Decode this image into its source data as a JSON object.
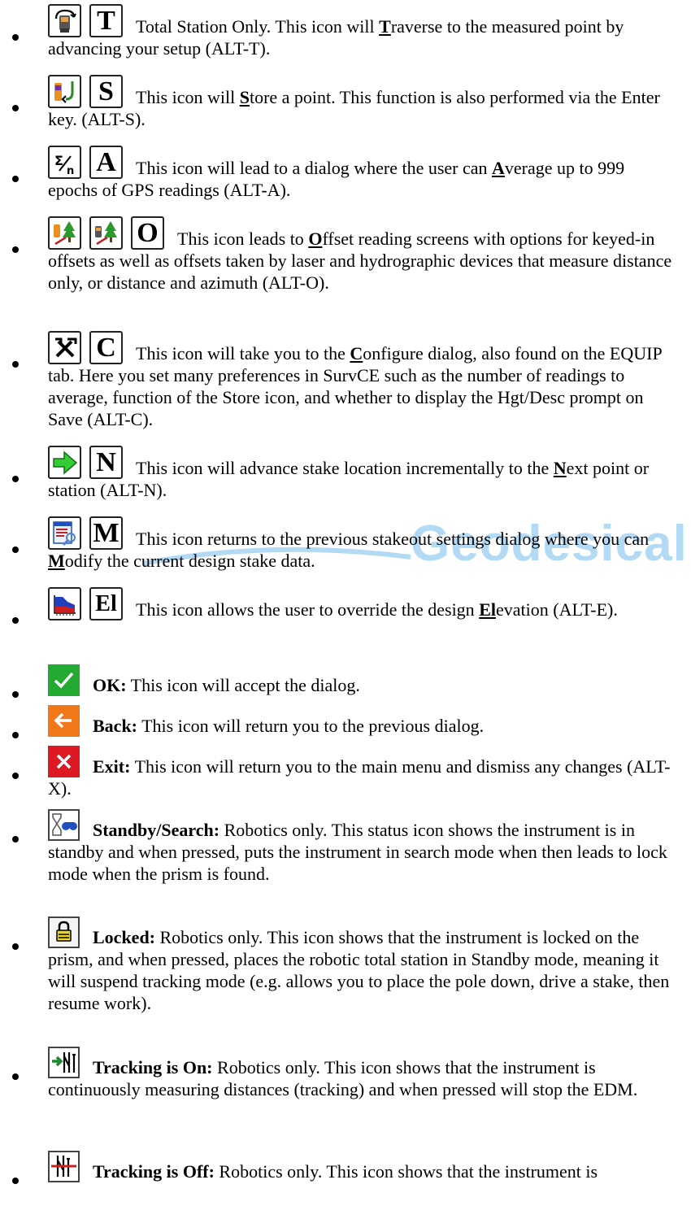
{
  "watermark": "Geodesical",
  "items": [
    {
      "icons": [
        "traverse-station-icon"
      ],
      "letter": "T",
      "text": "Total Station Only. This icon will",
      "key": "T",
      "rest": "raverse to the measured point by advancing your setup (ALT-T)."
    },
    {
      "icons": [
        "store-point-icon"
      ],
      "letter": "S",
      "text": "This icon will",
      "key": "S",
      "rest": "tore a point.  This function is also performed via the Enter key.  (ALT-S)."
    },
    {
      "icons": [
        "average-sigma-icon"
      ],
      "letter": "A",
      "text": "This icon will lead to a dialog where the user can",
      "key": "A",
      "rest": "verage up to 999 epochs of GPS readings (ALT-A)."
    },
    {
      "icons": [
        "offset-gps-icon",
        "offset-total-station-icon"
      ],
      "letter": "O",
      "text": "This icon leads to",
      "key": "O",
      "rest": "ffset reading screens with options for keyed-in offsets as well as offsets taken by laser and hydrographic devices that measure distance only, or distance and azimuth (ALT-O)."
    },
    {
      "icons": [
        "configure-tools-icon"
      ],
      "letter": "C",
      "text": "This icon will take you to the",
      "key": "C",
      "rest": "onfigure dialog, also found on the EQUIP tab.  Here you set many preferences in SurvCE such as the number of readings to average,  function of the Store icon, and whether to display the Hgt/Desc prompt on Save (ALT-C)."
    },
    {
      "icons": [
        "next-arrow-icon"
      ],
      "letter": "N",
      "text": "This icon will advance stake location incrementally to the",
      "key": "N",
      "rest": "ext point or station (ALT-N)."
    },
    {
      "icons": [
        "modify-stake-icon"
      ],
      "letter": "M",
      "text": "This icon returns to the previous stakeout settings dialog where you can",
      "key": "M",
      "rest": "odify the current design stake data."
    },
    {
      "icons": [
        "elevation-profile-icon"
      ],
      "letter": "El",
      "text": "This icon allows the user to override the design",
      "key": "El",
      "rest": "evation (ALT-E)."
    },
    {
      "icons": [
        "ok-check-icon"
      ],
      "letter": "",
      "label": "OK:",
      "text": "This icon will accept the dialog."
    },
    {
      "icons": [
        "back-arrow-icon"
      ],
      "letter": "",
      "label": "Back:",
      "text": "This icon will return you to the previous dialog."
    },
    {
      "icons": [
        "exit-x-icon"
      ],
      "letter": "",
      "label": "Exit:",
      "text": "This icon will return you to the main menu and dismiss any changes (ALT-X)."
    },
    {
      "icons": [
        "standby-search-icon"
      ],
      "letter": "",
      "label": "Standby/Search:",
      "text": "Robotics only. This status icon shows the instrument is in standby and when pressed, puts the instrument in search mode when then leads to lock mode when the prism is found."
    },
    {
      "icons": [
        "locked-padlock-icon"
      ],
      "letter": "",
      "label": "Locked:",
      "text": "Robotics only. This icon shows that the instrument is locked on the prism, and when pressed, places the robotic total station in Standby mode, meaning it will suspend tracking mode (e.g. allows you to place the pole down, drive a stake, then resume work)."
    },
    {
      "icons": [
        "tracking-on-icon"
      ],
      "letter": "",
      "label": "Tracking is On:",
      "text": "Robotics only. This icon shows that the instrument is continuously measuring distances (tracking) and when pressed will stop the EDM."
    },
    {
      "icons": [
        "tracking-off-icon"
      ],
      "letter": "",
      "label": "Tracking is Off:",
      "text": "Robotics only. This icon shows that the instrument is"
    }
  ]
}
